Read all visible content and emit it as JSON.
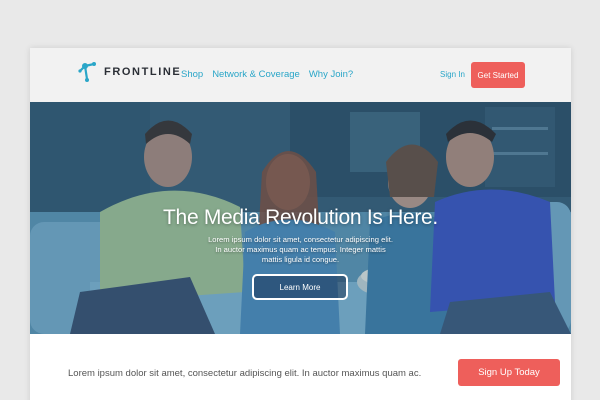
{
  "header": {
    "logo_text": "FRONTLINE",
    "nav": [
      "Shop",
      "Network & Coverage",
      "Why Join?"
    ],
    "sign_in": "Sign In",
    "cta": "Get Started"
  },
  "hero": {
    "title": "The Media Revolution Is Here.",
    "body": "Lorem ipsum dolor sit amet, consectetur adipiscing elit. In auctor maximus quam ac tempus. Integer mattis mattis ligula id congue.",
    "button": "Learn More"
  },
  "band": {
    "text": "Lorem ipsum dolor sit amet, consectetur adipiscing elit. In auctor maximus quam ac.",
    "button": "Sign Up Today"
  },
  "colors": {
    "accent": "#ee5f5b",
    "link": "#2aa6c8",
    "header_bg": "#f2f2f2"
  },
  "icons": {
    "logo": "frontline-logo-icon"
  }
}
